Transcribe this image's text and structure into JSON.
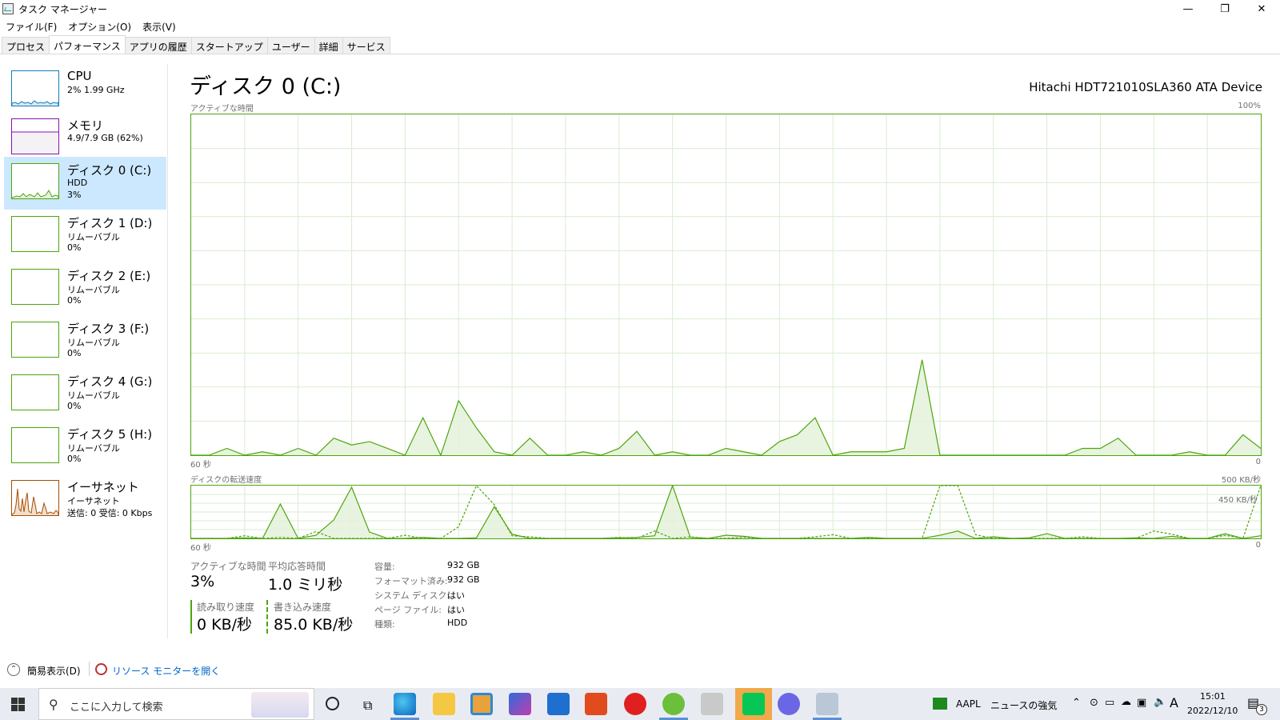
{
  "window": {
    "title": "タスク マネージャー",
    "controls": [
      "—",
      "❐",
      "✕"
    ]
  },
  "menu": [
    "ファイル(F)",
    "オプション(O)",
    "表示(V)"
  ],
  "tabs": [
    "プロセス",
    "パフォーマンス",
    "アプリの履歴",
    "スタートアップ",
    "ユーザー",
    "詳細",
    "サービス"
  ],
  "active_tab": "パフォーマンス",
  "sidebar": [
    {
      "name": "CPU",
      "sub1": "2%  1.99 GHz",
      "sub2": "",
      "type": "cpu"
    },
    {
      "name": "メモリ",
      "sub1": "4.9/7.9 GB (62%)",
      "sub2": "",
      "type": "mem"
    },
    {
      "name": "ディスク 0 (C:)",
      "sub1": "HDD",
      "sub2": "3%",
      "type": "disk",
      "selected": true
    },
    {
      "name": "ディスク 1 (D:)",
      "sub1": "リムーバブル",
      "sub2": "0%",
      "type": "disk"
    },
    {
      "name": "ディスク 2 (E:)",
      "sub1": "リムーバブル",
      "sub2": "0%",
      "type": "disk"
    },
    {
      "name": "ディスク 3 (F:)",
      "sub1": "リムーバブル",
      "sub2": "0%",
      "type": "disk"
    },
    {
      "name": "ディスク 4 (G:)",
      "sub1": "リムーバブル",
      "sub2": "0%",
      "type": "disk"
    },
    {
      "name": "ディスク 5 (H:)",
      "sub1": "リムーバブル",
      "sub2": "0%",
      "type": "disk"
    },
    {
      "name": "イーサネット",
      "sub1": "イーサネット",
      "sub2": "送信: 0 受信: 0 Kbps",
      "type": "net"
    }
  ],
  "main": {
    "title": "ディスク 0 (C:)",
    "device": "Hitachi HDT721010SLA360 ATA Device",
    "graph1": {
      "label": "アクティブな時間",
      "max": "100%",
      "left_bottom": "60 秒",
      "right_bottom": "0"
    },
    "graph2": {
      "label": "ディスクの転送速度",
      "max": "500 KB/秒",
      "inner": "450 KB/秒",
      "left_bottom": "60 秒",
      "right_bottom": "0"
    }
  },
  "stats": {
    "active_label": "アクティブな時間",
    "active_value": "3%",
    "resp_label": "平均応答時間",
    "resp_value": "1.0 ミリ秒",
    "read_label": "読み取り速度",
    "read_value": "0 KB/秒",
    "write_label": "書き込み速度",
    "write_value": "85.0 KB/秒"
  },
  "details": [
    {
      "k": "容量:",
      "v": "932 GB"
    },
    {
      "k": "フォーマット済み:",
      "v": "932 GB"
    },
    {
      "k": "システム ディスク:",
      "v": "はい"
    },
    {
      "k": "ページ ファイル:",
      "v": "はい"
    },
    {
      "k": "種類:",
      "v": "HDD"
    }
  ],
  "footer": {
    "simple": "簡易表示(D)",
    "resmon": "リソース モニターを開く"
  },
  "taskbar": {
    "search_placeholder": "ここに入力して検索",
    "stock": "AAPL",
    "news": "ニュースの強気",
    "ime": "A",
    "time": "15:01",
    "date": "2022/12/10",
    "notif": "3"
  },
  "active_series": [
    0,
    0,
    2,
    0,
    1,
    0,
    2,
    0,
    5,
    3,
    4,
    2,
    0,
    11,
    0,
    16,
    8,
    1,
    0,
    5,
    0,
    0,
    1,
    0,
    2,
    7,
    0,
    1,
    0,
    0,
    2,
    1,
    0,
    4,
    6,
    11,
    0,
    1,
    1,
    1,
    2,
    28,
    0,
    0,
    0,
    0,
    0,
    0,
    0,
    0,
    2,
    2,
    5,
    0,
    0,
    0,
    1,
    0,
    0,
    6,
    2
  ],
  "transfer_read": [
    0,
    0,
    0,
    1,
    0,
    65,
    0,
    6,
    35,
    97,
    12,
    0,
    0,
    2,
    0,
    0,
    1,
    60,
    8,
    0,
    0,
    0,
    0,
    0,
    1,
    2,
    5,
    100,
    2,
    0,
    6,
    4,
    0,
    0,
    0,
    0,
    0,
    0,
    2,
    0,
    0,
    0,
    6,
    14,
    0,
    3,
    0,
    1,
    9,
    0,
    0,
    0,
    0,
    1,
    0,
    4,
    0,
    0,
    9,
    0,
    5
  ],
  "transfer_write": [
    0,
    0,
    0,
    5,
    0,
    2,
    0,
    13,
    0,
    0,
    0,
    0,
    6,
    0,
    0,
    22,
    100,
    64,
    5,
    3,
    0,
    0,
    0,
    0,
    2,
    0,
    14,
    0,
    3,
    0,
    0,
    2,
    0,
    0,
    0,
    3,
    7,
    0,
    0,
    0,
    0,
    0,
    100,
    100,
    7,
    0,
    0,
    0,
    0,
    0,
    3,
    0,
    0,
    0,
    14,
    8,
    0,
    0,
    6,
    0,
    100
  ]
}
